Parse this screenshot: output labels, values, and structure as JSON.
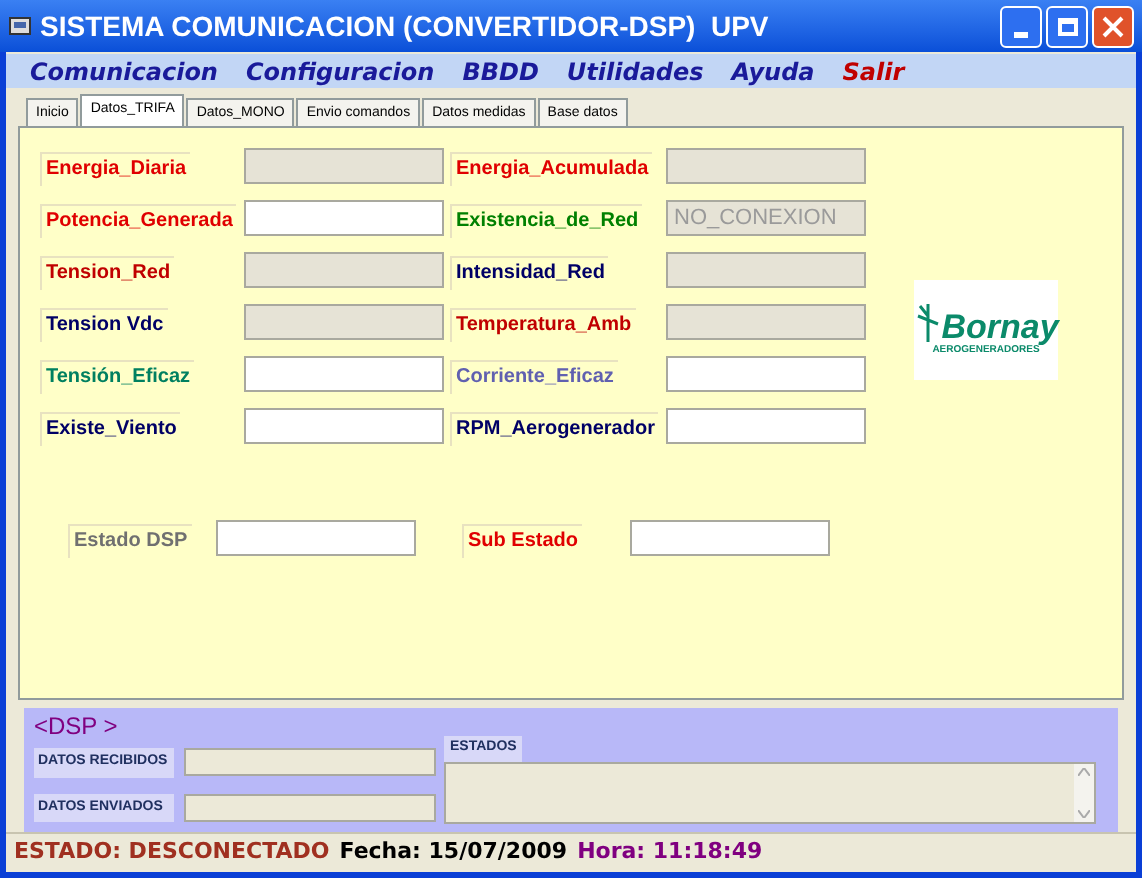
{
  "window": {
    "title": "SISTEMA COMUNICACION (CONVERTIDOR-DSP)  UPV"
  },
  "menu": [
    {
      "label": "Comunicacion",
      "kind": "normal"
    },
    {
      "label": "Configuracion",
      "kind": "normal"
    },
    {
      "label": "BBDD",
      "kind": "normal"
    },
    {
      "label": "Utilidades",
      "kind": "normal"
    },
    {
      "label": "Ayuda",
      "kind": "normal"
    },
    {
      "label": "Salir",
      "kind": "exit"
    }
  ],
  "tabs": [
    {
      "label": "Inicio",
      "selected": false
    },
    {
      "label": "Datos_TRIFA",
      "selected": true
    },
    {
      "label": "Datos_MONO",
      "selected": false
    },
    {
      "label": "Envio comandos",
      "selected": false
    },
    {
      "label": "Datos medidas",
      "selected": false
    },
    {
      "label": "Base datos",
      "selected": false
    }
  ],
  "rows": [
    [
      {
        "label": "Energia_Diaria",
        "color": "#e00000",
        "disabled": true
      },
      {
        "label": "Energia_Acumulada",
        "color": "#e00000",
        "disabled": true
      }
    ],
    [
      {
        "label": "Potencia_Generada",
        "color": "#e00000",
        "disabled": false
      },
      {
        "label": "Existencia_de_Red",
        "color": "#008000",
        "disabled": true,
        "value": "NO_CONEXION"
      }
    ],
    [
      {
        "label": "Tension_Red",
        "color": "#c00000",
        "disabled": true
      },
      {
        "label": "Intensidad_Red",
        "color": "#000066",
        "disabled": true
      }
    ],
    [
      {
        "label": "Tension Vdc",
        "color": "#000066",
        "disabled": true
      },
      {
        "label": "Temperatura_Amb",
        "color": "#c00000",
        "disabled": true
      }
    ],
    [
      {
        "label": "Tensión_Eficaz",
        "color": "#008060",
        "disabled": false
      },
      {
        "label": "Corriente_Eficaz",
        "color": "#6060b0",
        "disabled": false
      }
    ],
    [
      {
        "label": "Existe_Viento",
        "color": "#000066",
        "disabled": false
      },
      {
        "label": "RPM_Aerogenerador",
        "color": "#000066",
        "disabled": false
      }
    ]
  ],
  "status_row": [
    {
      "label": "Estado DSP",
      "color": "#707070",
      "disabled": false
    },
    {
      "label": "Sub Estado",
      "color": "#e00000",
      "disabled": false
    }
  ],
  "logo": {
    "name": "Bornay",
    "subtitle": "AEROGENERADORES"
  },
  "dsp": {
    "title": "<DSP >",
    "received_label": "DATOS RECIBIDOS",
    "sent_label": "DATOS ENVIADOS",
    "states_label": "ESTADOS"
  },
  "status_bar": {
    "state": "ESTADO: DESCONECTADO",
    "date": "Fecha: 15/07/2009",
    "time": "Hora: 11:18:49"
  }
}
